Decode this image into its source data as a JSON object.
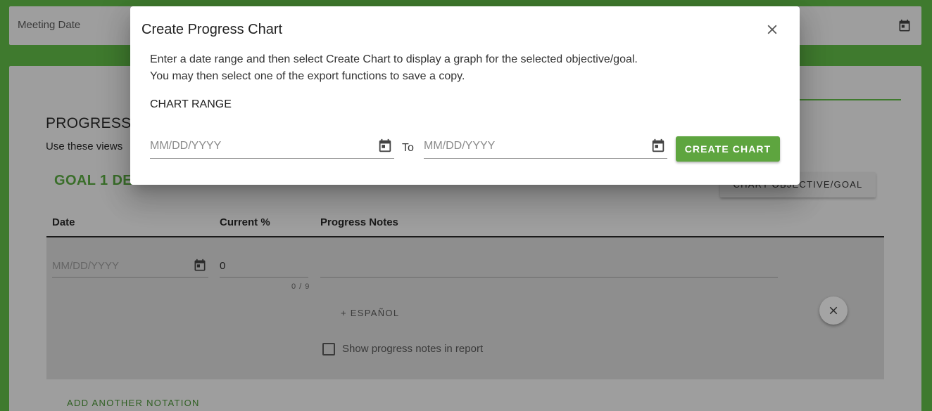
{
  "background": {
    "meeting_date_label": "Meeting Date",
    "progress_title": "PROGRESS I",
    "progress_subtitle": "Use these views",
    "goal_title": "GOAL 1 DESCRIPTION",
    "chart_button_label": "CHART OBJECTIVE/GOAL",
    "table": {
      "headers": [
        "Date",
        "Current %",
        "Progress Notes"
      ],
      "row": {
        "date_placeholder": "MM/DD/YYYY",
        "current_value": "0",
        "counter": "0 / 9",
        "notes_value": ""
      }
    },
    "espanol_label": "+ ESPAÑOL",
    "show_notes_label": "Show progress notes in report",
    "show_notes_checked": false,
    "add_notation_label": "ADD ANOTHER NOTATION"
  },
  "dialog": {
    "title": "Create Progress Chart",
    "instructions_line1": "Enter a date range and then select Create Chart to display a graph for the selected objective/goal.",
    "instructions_line2": "You may then select one of the export functions to save a copy.",
    "chart_range_label": "CHART RANGE",
    "from_placeholder": "MM/DD/YYYY",
    "to_label": "To",
    "to_placeholder": "MM/DD/YYYY",
    "create_button_label": "CREATE CHART"
  },
  "icons": {
    "calendar": "calendar-icon",
    "close": "close-icon"
  },
  "colors": {
    "brand_green": "#5ea53f",
    "page_green": "#3f7a2e",
    "goal_green": "#3a6e2a"
  }
}
